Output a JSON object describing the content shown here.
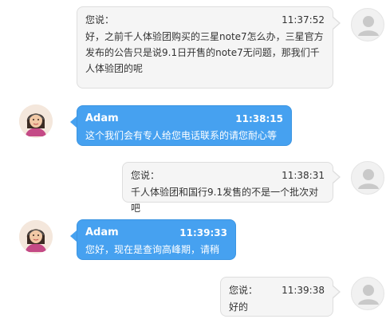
{
  "messages": [
    {
      "sender": "您说：",
      "time": "11:37:52",
      "text": "好，之前千人体验团购买的三星note7怎么办，三星官方发布的公告只是说9.1日开售的note7无问题，那我们千人体验团的呢"
    },
    {
      "sender": "Adam",
      "time": "11:38:15",
      "text": "这个我们会有专人给您电话联系的请您耐心等候"
    },
    {
      "sender": "您说：",
      "time": "11:38:31",
      "text": "千人体验团和国行9.1发售的不是一个批次对吧"
    },
    {
      "sender": "Adam",
      "time": "11:39:33",
      "text": "您好，现在是查询高峰期，请稍等!"
    },
    {
      "sender": "您说：",
      "time": "11:39:38",
      "text": "好的"
    }
  ],
  "colors": {
    "agent_bubble": "#46a1f0",
    "user_bubble": "#f5f5f5"
  },
  "icons": {
    "user_avatar": "default-user-avatar-icon",
    "agent_avatar": "support-agent-avatar-icon"
  }
}
